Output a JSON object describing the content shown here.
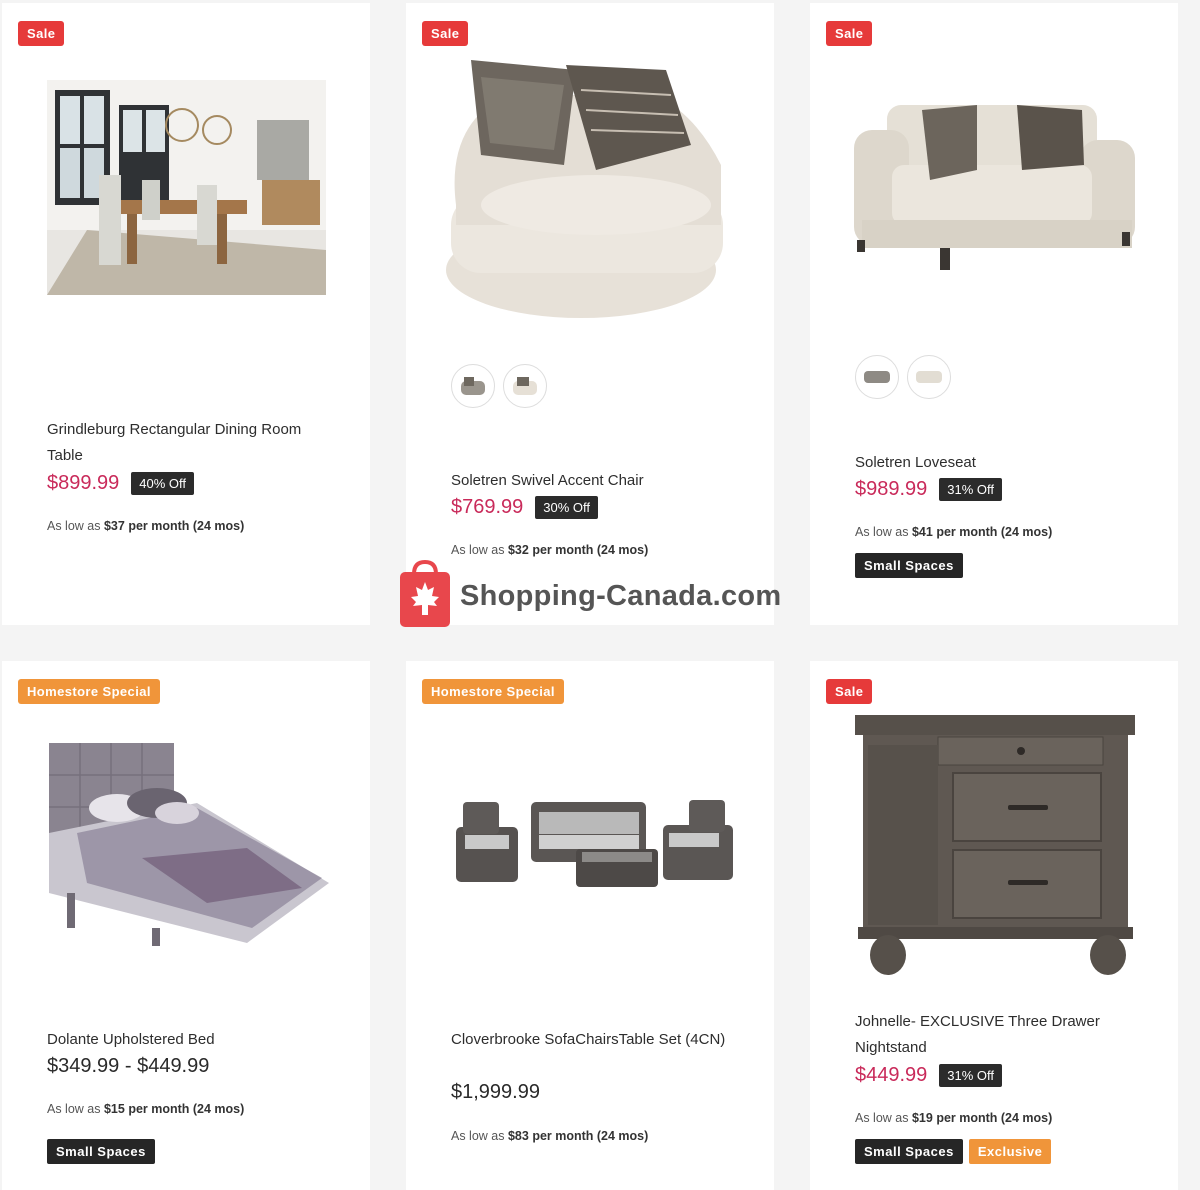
{
  "products": [
    {
      "badge": "Sale",
      "title": "Grindleburg Rectangular Dining Room Table",
      "price": "$899.99",
      "discount": "40% Off",
      "finance_prefix": "As low as",
      "finance_amount": "$37 per month (24 mos)"
    },
    {
      "badge": "Sale",
      "title": "Soletren Swivel Accent Chair",
      "price": "$769.99",
      "discount": "30% Off",
      "finance_prefix": "As low as",
      "finance_amount": "$32 per month (24 mos)"
    },
    {
      "badge": "Sale",
      "title": "Soletren Loveseat",
      "price": "$989.99",
      "discount": "31% Off",
      "finance_prefix": "As low as",
      "finance_amount": "$41 per month (24 mos)",
      "tags": [
        "Small Spaces"
      ]
    },
    {
      "badge": "Homestore Special",
      "title": "Dolante Upholstered Bed",
      "price": "$349.99 - $449.99",
      "finance_prefix": "As low as",
      "finance_amount": "$15 per month (24 mos)",
      "tags": [
        "Small Spaces"
      ]
    },
    {
      "badge": "Homestore Special",
      "title": "Cloverbrooke SofaChairsTable Set (4CN)",
      "price": "$1,999.99",
      "finance_prefix": "As low as",
      "finance_amount": "$83 per month (24 mos)"
    },
    {
      "badge": "Sale",
      "title": "Johnelle- EXCLUSIVE Three Drawer Nightstand",
      "price": "$449.99",
      "discount": "31% Off",
      "finance_prefix": "As low as",
      "finance_amount": "$19 per month (24 mos)",
      "tags": [
        "Small Spaces",
        "Exclusive"
      ]
    }
  ],
  "watermark": {
    "text": "Shopping-Canada.com"
  },
  "colors": {
    "sale": "#e63a3a",
    "special": "#f0953a",
    "price": "#c92a5a"
  }
}
